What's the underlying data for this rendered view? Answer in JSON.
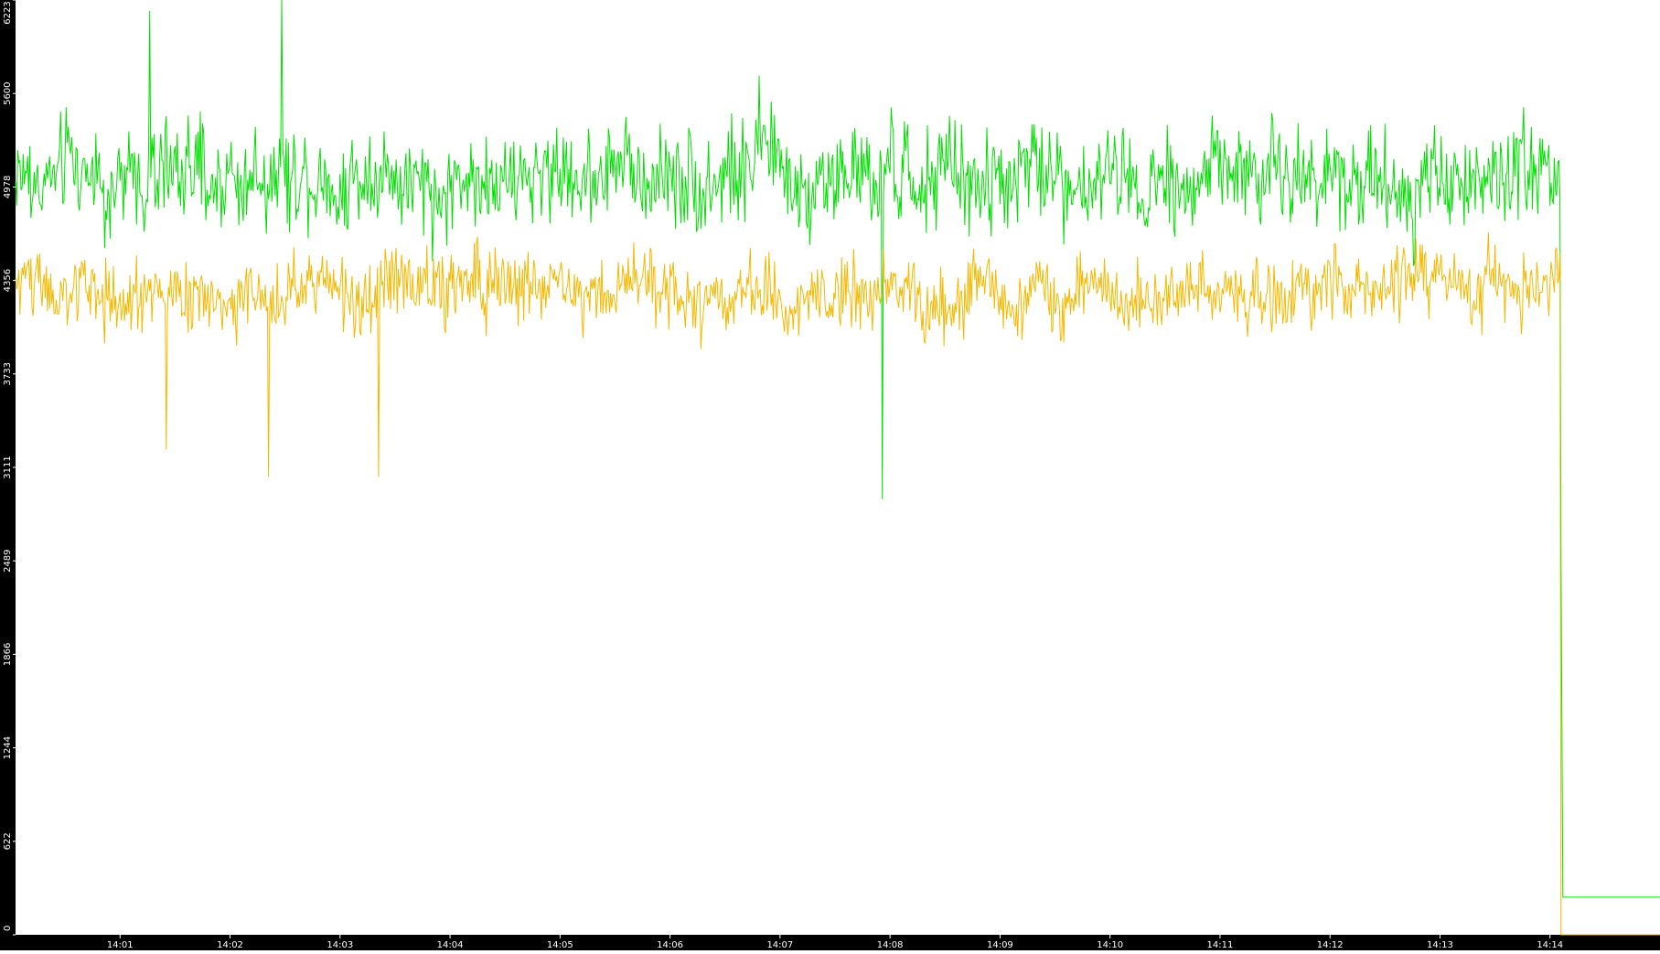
{
  "chart_data": {
    "type": "line",
    "title": "",
    "xlabel": "",
    "ylabel": "",
    "ylim": [
      0,
      6223
    ],
    "y_ticks": [
      "0",
      "622",
      "1244",
      "1866",
      "2489",
      "3111",
      "3733",
      "4356",
      "4978",
      "5600",
      "6223"
    ],
    "x_ticks": [
      "14:01",
      "14:02",
      "14:03",
      "14:04",
      "14:05",
      "14:06",
      "14:07",
      "14:08",
      "14:09",
      "14:10",
      "14:11",
      "14:12",
      "14:13",
      "14:14"
    ],
    "x_range_minutes": [
      "14:00:03",
      "14:15:00"
    ],
    "data_end_time": "14:14:06",
    "grid": false,
    "legend": "none",
    "colors": {
      "axis_bar": "#000000",
      "axis_text": "#ffffff",
      "plot_background": "#ffffff"
    },
    "series": [
      {
        "color": "#00e000",
        "mean": 5050,
        "noise_spread": 320,
        "spikes": [
          {
            "time": "14:01:16",
            "value": 6150
          },
          {
            "time": "14:02:28",
            "value": 6223
          },
          {
            "time": "14:07:56",
            "value": 2900
          },
          {
            "time": "14:14:06",
            "value": 2450
          }
        ],
        "tail": {
          "from": "14:14:07",
          "to": "14:15:00",
          "value": 250
        }
      },
      {
        "color": "#f5b800",
        "mean": 4300,
        "noise_spread": 230,
        "spikes": [
          {
            "time": "14:01:25",
            "value": 3230
          },
          {
            "time": "14:02:21",
            "value": 3050
          },
          {
            "time": "14:03:21",
            "value": 3050
          },
          {
            "time": "14:14:06",
            "value": 0
          }
        ],
        "tail": {
          "from": "14:14:06",
          "to": "14:15:00",
          "value": 0
        }
      }
    ]
  }
}
